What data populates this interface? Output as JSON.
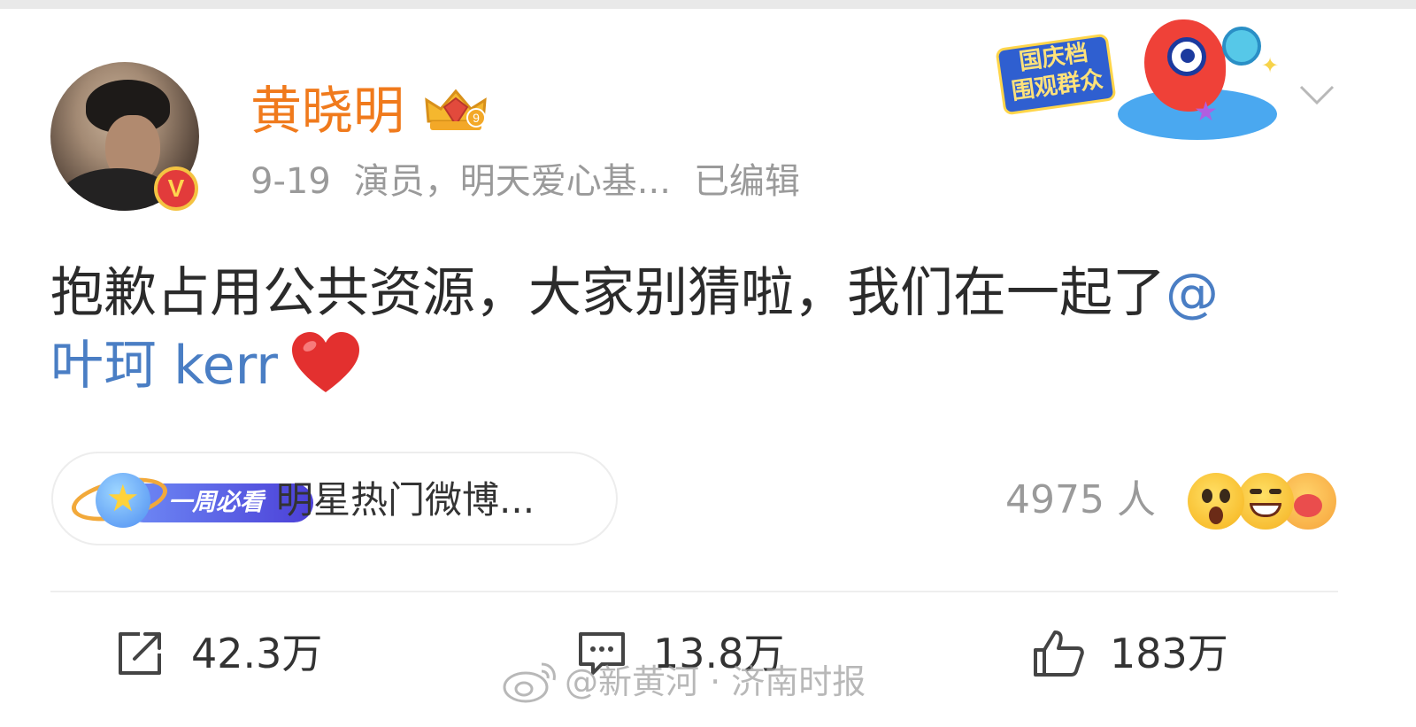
{
  "post": {
    "author": "黄晓明",
    "date": "9-19",
    "bio": "演员，明天爱心基...",
    "edited": "已编辑",
    "text": "抱歉占用公共资源，大家别猜啦，我们在一起了",
    "mention_at": "@",
    "mention_name": "叶珂 kerr"
  },
  "badges": {
    "verified": "V",
    "holiday_line1": "国庆档",
    "holiday_line2": "围观群众"
  },
  "topic": {
    "badge_label": "一周必看",
    "title": "明星热门微博..."
  },
  "reactions": {
    "count_label": "4975 人"
  },
  "actions": {
    "repost": "42.3万",
    "comment": "13.8万",
    "like": "183万"
  },
  "watermark": "@新黄河 · 济南时报",
  "colors": {
    "username": "#f07a1c",
    "mention": "#4a7ec4",
    "meta": "#9a9a9a"
  },
  "icons": [
    "chevron-down-icon",
    "repost-icon",
    "comment-icon",
    "like-icon",
    "heart-emoji-icon",
    "crown-icon",
    "weibo-logo-icon"
  ]
}
